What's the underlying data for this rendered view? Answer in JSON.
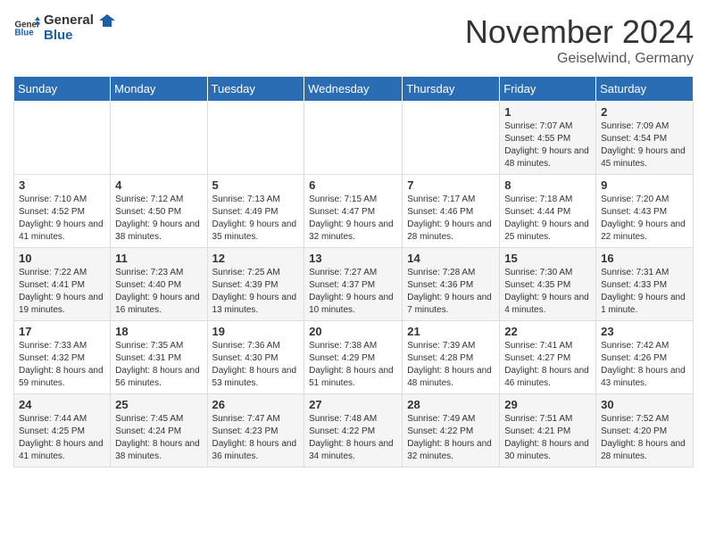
{
  "logo": {
    "line1": "General",
    "line2": "Blue"
  },
  "title": "November 2024",
  "location": "Geiselwind, Germany",
  "headers": [
    "Sunday",
    "Monday",
    "Tuesday",
    "Wednesday",
    "Thursday",
    "Friday",
    "Saturday"
  ],
  "weeks": [
    [
      {
        "day": "",
        "info": ""
      },
      {
        "day": "",
        "info": ""
      },
      {
        "day": "",
        "info": ""
      },
      {
        "day": "",
        "info": ""
      },
      {
        "day": "",
        "info": ""
      },
      {
        "day": "1",
        "info": "Sunrise: 7:07 AM\nSunset: 4:55 PM\nDaylight: 9 hours and 48 minutes."
      },
      {
        "day": "2",
        "info": "Sunrise: 7:09 AM\nSunset: 4:54 PM\nDaylight: 9 hours and 45 minutes."
      }
    ],
    [
      {
        "day": "3",
        "info": "Sunrise: 7:10 AM\nSunset: 4:52 PM\nDaylight: 9 hours and 41 minutes."
      },
      {
        "day": "4",
        "info": "Sunrise: 7:12 AM\nSunset: 4:50 PM\nDaylight: 9 hours and 38 minutes."
      },
      {
        "day": "5",
        "info": "Sunrise: 7:13 AM\nSunset: 4:49 PM\nDaylight: 9 hours and 35 minutes."
      },
      {
        "day": "6",
        "info": "Sunrise: 7:15 AM\nSunset: 4:47 PM\nDaylight: 9 hours and 32 minutes."
      },
      {
        "day": "7",
        "info": "Sunrise: 7:17 AM\nSunset: 4:46 PM\nDaylight: 9 hours and 28 minutes."
      },
      {
        "day": "8",
        "info": "Sunrise: 7:18 AM\nSunset: 4:44 PM\nDaylight: 9 hours and 25 minutes."
      },
      {
        "day": "9",
        "info": "Sunrise: 7:20 AM\nSunset: 4:43 PM\nDaylight: 9 hours and 22 minutes."
      }
    ],
    [
      {
        "day": "10",
        "info": "Sunrise: 7:22 AM\nSunset: 4:41 PM\nDaylight: 9 hours and 19 minutes."
      },
      {
        "day": "11",
        "info": "Sunrise: 7:23 AM\nSunset: 4:40 PM\nDaylight: 9 hours and 16 minutes."
      },
      {
        "day": "12",
        "info": "Sunrise: 7:25 AM\nSunset: 4:39 PM\nDaylight: 9 hours and 13 minutes."
      },
      {
        "day": "13",
        "info": "Sunrise: 7:27 AM\nSunset: 4:37 PM\nDaylight: 9 hours and 10 minutes."
      },
      {
        "day": "14",
        "info": "Sunrise: 7:28 AM\nSunset: 4:36 PM\nDaylight: 9 hours and 7 minutes."
      },
      {
        "day": "15",
        "info": "Sunrise: 7:30 AM\nSunset: 4:35 PM\nDaylight: 9 hours and 4 minutes."
      },
      {
        "day": "16",
        "info": "Sunrise: 7:31 AM\nSunset: 4:33 PM\nDaylight: 9 hours and 1 minute."
      }
    ],
    [
      {
        "day": "17",
        "info": "Sunrise: 7:33 AM\nSunset: 4:32 PM\nDaylight: 8 hours and 59 minutes."
      },
      {
        "day": "18",
        "info": "Sunrise: 7:35 AM\nSunset: 4:31 PM\nDaylight: 8 hours and 56 minutes."
      },
      {
        "day": "19",
        "info": "Sunrise: 7:36 AM\nSunset: 4:30 PM\nDaylight: 8 hours and 53 minutes."
      },
      {
        "day": "20",
        "info": "Sunrise: 7:38 AM\nSunset: 4:29 PM\nDaylight: 8 hours and 51 minutes."
      },
      {
        "day": "21",
        "info": "Sunrise: 7:39 AM\nSunset: 4:28 PM\nDaylight: 8 hours and 48 minutes."
      },
      {
        "day": "22",
        "info": "Sunrise: 7:41 AM\nSunset: 4:27 PM\nDaylight: 8 hours and 46 minutes."
      },
      {
        "day": "23",
        "info": "Sunrise: 7:42 AM\nSunset: 4:26 PM\nDaylight: 8 hours and 43 minutes."
      }
    ],
    [
      {
        "day": "24",
        "info": "Sunrise: 7:44 AM\nSunset: 4:25 PM\nDaylight: 8 hours and 41 minutes."
      },
      {
        "day": "25",
        "info": "Sunrise: 7:45 AM\nSunset: 4:24 PM\nDaylight: 8 hours and 38 minutes."
      },
      {
        "day": "26",
        "info": "Sunrise: 7:47 AM\nSunset: 4:23 PM\nDaylight: 8 hours and 36 minutes."
      },
      {
        "day": "27",
        "info": "Sunrise: 7:48 AM\nSunset: 4:22 PM\nDaylight: 8 hours and 34 minutes."
      },
      {
        "day": "28",
        "info": "Sunrise: 7:49 AM\nSunset: 4:22 PM\nDaylight: 8 hours and 32 minutes."
      },
      {
        "day": "29",
        "info": "Sunrise: 7:51 AM\nSunset: 4:21 PM\nDaylight: 8 hours and 30 minutes."
      },
      {
        "day": "30",
        "info": "Sunrise: 7:52 AM\nSunset: 4:20 PM\nDaylight: 8 hours and 28 minutes."
      }
    ]
  ]
}
